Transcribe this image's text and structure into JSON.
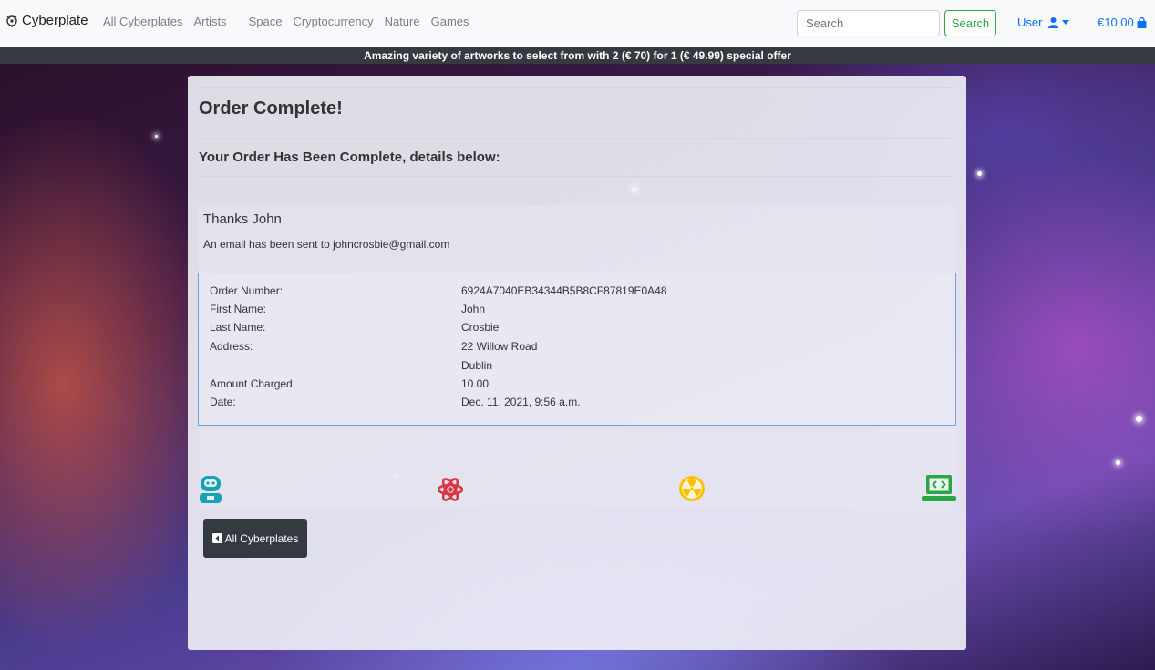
{
  "navbar": {
    "brand": "Cyberplate",
    "links": [
      "All Cyberplates",
      "Artists",
      "Space",
      "Cryptocurrency",
      "Nature",
      "Games"
    ],
    "search_placeholder": "Search",
    "search_button": "Search",
    "user_label": "User",
    "cart_total": "€10.00"
  },
  "banner": {
    "text": "Amazing variety of artworks to select from with 2 (€ 70) for 1 (€ 49.99) special offer"
  },
  "order": {
    "title": "Order Complete!",
    "subtitle": "Your Order Has Been Complete, details below:",
    "thanks": "Thanks John",
    "email_note": "An email has been sent to johncrosbie@gmail.com",
    "details": [
      {
        "label": "Order Number:",
        "value": "6924A7040EB34344B5B8CF87819E0A48"
      },
      {
        "label": "First Name:",
        "value": "John"
      },
      {
        "label": "Last Name:",
        "value": "Crosbie"
      },
      {
        "label": "Address:",
        "value": "22 Willow Road"
      },
      {
        "label": "",
        "value": "Dublin"
      },
      {
        "label": "Amount Charged:",
        "value": "10.00"
      },
      {
        "label": "Date:",
        "value": "Dec. 11, 2021, 9:56 a.m."
      }
    ],
    "icons": [
      {
        "name": "robot-icon",
        "color": "#17a2b8"
      },
      {
        "name": "atom-icon",
        "color": "#dc3545"
      },
      {
        "name": "radiation-icon",
        "color": "#ffc107"
      },
      {
        "name": "laptop-code-icon",
        "color": "#28a745"
      }
    ],
    "back_button": "All Cyberplates"
  },
  "colors": {
    "primary": "#0d6efd",
    "success": "#28a745",
    "dark": "#343a40"
  }
}
